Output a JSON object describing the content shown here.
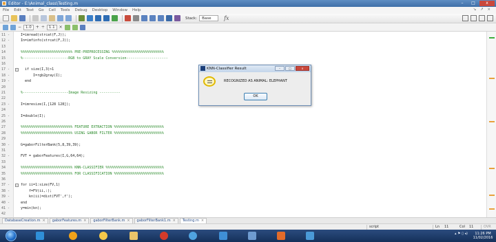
{
  "window": {
    "title": "Editor - E:\\Animal_class\\Testing.m",
    "minimize_glyph": "–",
    "maximize_glyph": "□",
    "close_glyph": "x"
  },
  "menu": {
    "items": [
      "File",
      "Edit",
      "Text",
      "Go",
      "Cell",
      "Tools",
      "Debug",
      "Desktop",
      "Window",
      "Help"
    ],
    "right_glyphs": "↘ ↗ ×"
  },
  "toolbar": {
    "stack_label": "Stack:",
    "stack_value": "Base",
    "fx_label": "fx"
  },
  "cell_toolbar": {
    "minus": "−",
    "value_a": "1.0",
    "plus": "+",
    "divide": "÷",
    "value_b": "1.1",
    "times": "×"
  },
  "editor": {
    "lines": [
      {
        "n": "11 -",
        "t": "I=imread(strcat(F,J));",
        "c": false
      },
      {
        "n": "12 -",
        "t": "In=imfinfo(strcat(F,J));",
        "c": false
      },
      {
        "n": "13",
        "t": "",
        "c": false
      },
      {
        "n": "14",
        "t": "%%%%%%%%%%%%%%%%%%%%%%%%% PRE-PREPROCESSING %%%%%%%%%%%%%%%%%%%%%%%%%",
        "c": true
      },
      {
        "n": "15",
        "t": "%----------------------RGB to GRAY Scale Conversion--------------------",
        "c": true
      },
      {
        "n": "16",
        "t": "",
        "c": false
      },
      {
        "n": "17 -",
        "t": "  if size(I,3)>1",
        "c": false,
        "fold": true
      },
      {
        "n": "18 -",
        "t": "      I=rgb2gray(I);",
        "c": false
      },
      {
        "n": "19 -",
        "t": "  end",
        "c": false
      },
      {
        "n": "20",
        "t": "",
        "c": false
      },
      {
        "n": "21",
        "t": "%----------------------Image Resizing ----------",
        "c": true
      },
      {
        "n": "22",
        "t": "",
        "c": false
      },
      {
        "n": "23 -",
        "t": "I=imresize(I,[128 128]);",
        "c": false
      },
      {
        "n": "24",
        "t": "",
        "c": false
      },
      {
        "n": "25 -",
        "t": "I=double(I);",
        "c": false
      },
      {
        "n": "26",
        "t": "",
        "c": false
      },
      {
        "n": "27",
        "t": "%%%%%%%%%%%%%%%%%%%%%%%%% FEATURE EXTRACTION %%%%%%%%%%%%%%%%%%%%%%%%",
        "c": true
      },
      {
        "n": "28",
        "t": "%%%%%%%%%%%%%%%%%%%%%%%%% USING GABOR FILTER %%%%%%%%%%%%%%%%%%%%%%%%",
        "c": true
      },
      {
        "n": "29",
        "t": "",
        "c": false
      },
      {
        "n": "30 -",
        "t": "G=gaborFilterBank(5,8,39,39);",
        "c": false
      },
      {
        "n": "31",
        "t": "",
        "c": false
      },
      {
        "n": "32 -",
        "t": "FVT = gaborFeatures(I,G,64,64);",
        "c": false
      },
      {
        "n": "33",
        "t": "",
        "c": false
      },
      {
        "n": "34",
        "t": "%%%%%%%%%%%%%%%%%%%%%%%%% KNN-CLASSIFIER %%%%%%%%%%%%%%%%%%%%%%%%%%%%",
        "c": true
      },
      {
        "n": "35",
        "t": "%%%%%%%%%%%%%%%%%%%%%%%%% FOR CLASSIFICATION %%%%%%%%%%%%%%%%%%%%%%%%",
        "c": true
      },
      {
        "n": "36",
        "t": "",
        "c": false
      },
      {
        "n": "37 -",
        "t": "for ii=1:size(FV,1)",
        "c": false,
        "fold": true
      },
      {
        "n": "38 -",
        "t": "    f=FV(ii,:);",
        "c": false
      },
      {
        "n": "39 -",
        "t": "    kn(ii)=dist(FVT',f');",
        "c": false
      },
      {
        "n": "40 -",
        "t": "end",
        "c": false
      },
      {
        "n": "41 -",
        "t": "y=min(kn);",
        "c": false
      },
      {
        "n": "42",
        "t": "",
        "c": false
      }
    ]
  },
  "file_tabs": [
    {
      "label": "DatabaseCreation.m",
      "active": false
    },
    {
      "label": "gaborFeatures.m",
      "active": false
    },
    {
      "label": "gaborFilterBank.m",
      "active": false
    },
    {
      "label": "gaborFilterBank1.m",
      "active": false
    },
    {
      "label": "Testing.m",
      "active": true
    }
  ],
  "tab_close_glyph": "×",
  "status": {
    "mode": "script",
    "line_label": "Ln",
    "line_value": "11",
    "col_label": "Col",
    "col_value": "11",
    "ovr": "OVR"
  },
  "taskbar": {
    "tray_glyphs": "▴ ⚑ ▯ ◂)",
    "time": "11:26 PM",
    "date": "11/02/2016"
  },
  "dialog": {
    "title": "KNN-Classifier Result",
    "min_glyph": "–",
    "max_glyph": "□",
    "close_glyph": "x",
    "message": "RECOGNIZED AS ANIMAL: ELEPHANT",
    "ok_label": "OK"
  },
  "colors": {
    "comment": "#2a8a2a",
    "accent": "#3f6fa8",
    "marker": "#e8a13c"
  }
}
